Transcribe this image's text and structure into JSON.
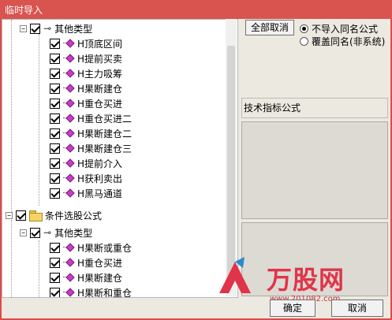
{
  "window": {
    "title": "临时导入"
  },
  "tree": {
    "group1": {
      "label": "其他类型",
      "items": [
        "H顶底区间",
        "H提前买卖",
        "H主力吸筹",
        "H果断建仓",
        "H重仓买进",
        "H重仓买进二",
        "H果断建仓二",
        "H果断建仓三",
        "H提前介入",
        "H获利卖出",
        "H黑马通道"
      ]
    },
    "folder": {
      "label": "条件选股公式"
    },
    "group2": {
      "label": "其他类型",
      "items": [
        "H果断或重仓",
        "H重仓买进",
        "H果断建仓",
        "H果断和重仓"
      ]
    }
  },
  "right": {
    "cancel_all_button": "全部取消",
    "option_no_import": "不导入同名公式",
    "option_overwrite": "覆盖同名(非系统)",
    "formula_label": "技术指标公式"
  },
  "buttons": {
    "ok": "确定",
    "cancel": "取消"
  },
  "watermark": {
    "text": "万股网",
    "url": "www.201082.com"
  }
}
